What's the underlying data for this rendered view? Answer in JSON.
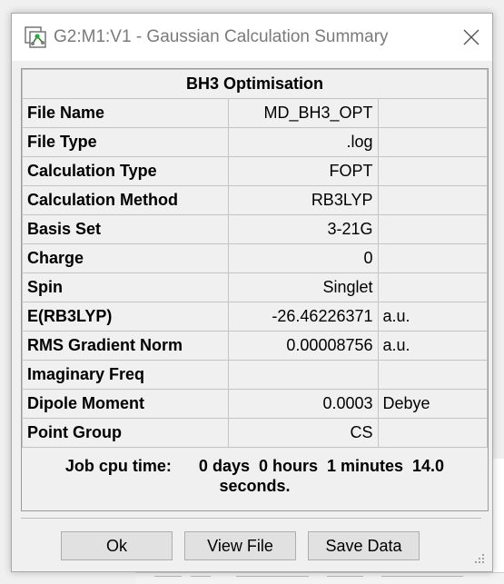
{
  "window": {
    "title": "G2:M1:V1 - Gaussian Calculation Summary"
  },
  "summary": {
    "heading": "BH3 Optimisation",
    "rows": [
      {
        "label": "File Name",
        "value": "MD_BH3_OPT",
        "unit": ""
      },
      {
        "label": "File Type",
        "value": ".log",
        "unit": ""
      },
      {
        "label": "Calculation Type",
        "value": "FOPT",
        "unit": ""
      },
      {
        "label": "Calculation Method",
        "value": "RB3LYP",
        "unit": ""
      },
      {
        "label": "Basis Set",
        "value": "3-21G",
        "unit": ""
      },
      {
        "label": "Charge",
        "value": "0",
        "unit": ""
      },
      {
        "label": "Spin",
        "value": "Singlet",
        "unit": ""
      },
      {
        "label": "E(RB3LYP)",
        "value": "-26.46226371",
        "unit": "a.u."
      },
      {
        "label": "RMS Gradient Norm",
        "value": "0.00008756",
        "unit": "a.u."
      },
      {
        "label": "Imaginary Freq",
        "value": "",
        "unit": ""
      },
      {
        "label": "Dipole Moment",
        "value": "0.0003",
        "unit": "Debye"
      },
      {
        "label": "Point Group",
        "value": "CS",
        "unit": ""
      }
    ],
    "cpu_time_line1": "Job cpu time:      0 days  0 hours  1 minutes  14.0",
    "cpu_time_line2": "seconds."
  },
  "buttons": {
    "ok": "Ok",
    "view_file": "View File",
    "save_data": "Save Data"
  },
  "colors": {
    "titlebar_bg": "#ffffff",
    "title_text": "#7a7a7a",
    "dialog_bg": "#f0f0f0",
    "grid_line": "#c4c4c4",
    "button_bg": "#e1e1e1",
    "button_border": "#adadad"
  },
  "icons": {
    "app": "gaussview-molecule-icon",
    "close": "close-icon",
    "resize": "resize-grip-icon"
  }
}
